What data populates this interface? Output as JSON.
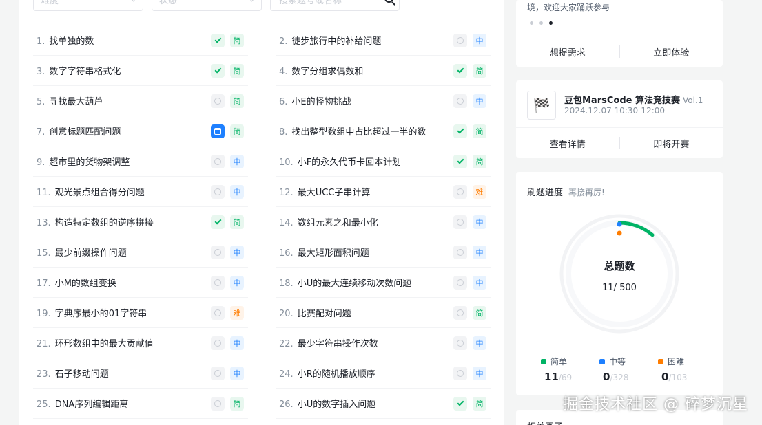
{
  "filters": {
    "difficulty_placeholder": "难度",
    "status_placeholder": "状态",
    "search_placeholder": "搜索题号或名称"
  },
  "problems": [
    {
      "num": "1.",
      "title": "找单独的数",
      "status": "done",
      "difficulty": "简"
    },
    {
      "num": "2.",
      "title": "徒步旅行中的补给问题",
      "status": "none",
      "difficulty": "中"
    },
    {
      "num": "3.",
      "title": "数字字符串格式化",
      "status": "done",
      "difficulty": "简"
    },
    {
      "num": "4.",
      "title": "数字分组求偶数和",
      "status": "done",
      "difficulty": "简"
    },
    {
      "num": "5.",
      "title": "寻找最大葫芦",
      "status": "none",
      "difficulty": "简"
    },
    {
      "num": "6.",
      "title": "小E的怪物挑战",
      "status": "none",
      "difficulty": "中"
    },
    {
      "num": "7.",
      "title": "创意标题匹配问题",
      "status": "calendar",
      "difficulty": "简"
    },
    {
      "num": "8.",
      "title": "找出整型数组中占比超过一半的数",
      "status": "done",
      "difficulty": "简"
    },
    {
      "num": "9.",
      "title": "超市里的货物架调整",
      "status": "none",
      "difficulty": "中"
    },
    {
      "num": "10.",
      "title": "小F的永久代币卡回本计划",
      "status": "done",
      "difficulty": "简"
    },
    {
      "num": "11.",
      "title": "观光景点组合得分问题",
      "status": "none",
      "difficulty": "中"
    },
    {
      "num": "12.",
      "title": "最大UCC子串计算",
      "status": "none",
      "difficulty": "难"
    },
    {
      "num": "13.",
      "title": "构造特定数组的逆序拼接",
      "status": "done",
      "difficulty": "简"
    },
    {
      "num": "14.",
      "title": "数组元素之和最小化",
      "status": "none",
      "difficulty": "中"
    },
    {
      "num": "15.",
      "title": "最少前缀操作问题",
      "status": "none",
      "difficulty": "中"
    },
    {
      "num": "16.",
      "title": "最大矩形面积问题",
      "status": "none",
      "difficulty": "中"
    },
    {
      "num": "17.",
      "title": "小M的数组变换",
      "status": "none",
      "difficulty": "中"
    },
    {
      "num": "18.",
      "title": "小U的最大连续移动次数问题",
      "status": "none",
      "difficulty": "中"
    },
    {
      "num": "19.",
      "title": "字典序最小的01字符串",
      "status": "none",
      "difficulty": "难"
    },
    {
      "num": "20.",
      "title": "比赛配对问题",
      "status": "none",
      "difficulty": "简"
    },
    {
      "num": "21.",
      "title": "环形数组中的最大贡献值",
      "status": "none",
      "difficulty": "中"
    },
    {
      "num": "22.",
      "title": "最少字符串操作次数",
      "status": "none",
      "difficulty": "中"
    },
    {
      "num": "23.",
      "title": "石子移动问题",
      "status": "none",
      "difficulty": "中"
    },
    {
      "num": "24.",
      "title": "小R的随机播放顺序",
      "status": "none",
      "difficulty": "中"
    },
    {
      "num": "25.",
      "title": "DNA序列编辑距离",
      "status": "none",
      "difficulty": "简"
    },
    {
      "num": "26.",
      "title": "小U的数字插入问题",
      "status": "done",
      "difficulty": "简"
    }
  ],
  "banner": {
    "text": "境，欢迎大家踊跃参与",
    "action_left": "想提需求",
    "action_right": "立即体验"
  },
  "contest": {
    "title": "豆包MarsCode 算法竞技赛",
    "vol": "Vol.1",
    "time": "2024.12.07 10:30-12:00",
    "action_left": "查看详情",
    "action_right": "即将开赛"
  },
  "progress": {
    "title": "刷题进度",
    "subtitle": "再接再厉!",
    "total_label": "总题数",
    "total_value": "11/ 500",
    "solved": 11,
    "total": 500,
    "legend": [
      {
        "label": "简单",
        "done": "11",
        "total": "/69",
        "color": "#00b365"
      },
      {
        "label": "中等",
        "done": "0",
        "total": "/328",
        "color": "#1e80ff"
      },
      {
        "label": "困难",
        "done": "0",
        "total": "/103",
        "color": "#ff7d00"
      }
    ]
  },
  "related": {
    "title": "相关圈子"
  },
  "watermark": "掘金技术社区 @ 碎梦沉星"
}
